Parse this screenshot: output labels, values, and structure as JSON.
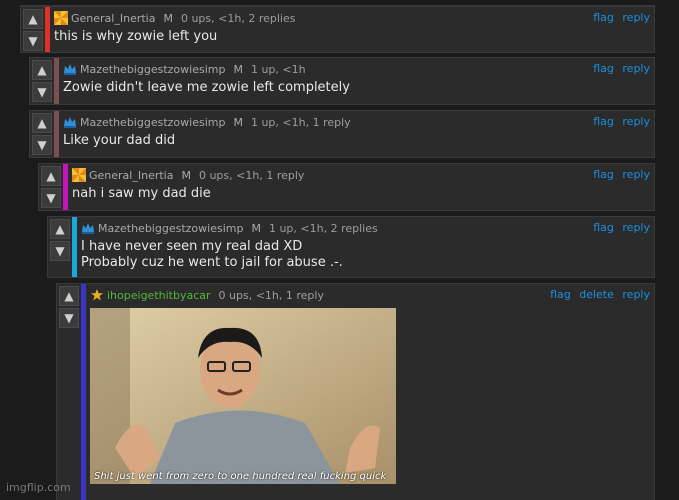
{
  "comments": [
    {
      "username": "General_Inertia",
      "mod": "M",
      "stats": "0 ups, <1h, 2 replies",
      "actions": [
        "flag",
        "reply"
      ],
      "text": "this is why zowie left you",
      "bar_color": "#e0302a",
      "avatar": "pinwheel-avatar"
    },
    {
      "username": "Mazethebiggestzowiesimp",
      "mod": "M",
      "stats": "1 up, <1h",
      "actions": [
        "flag",
        "reply"
      ],
      "text": "Zowie didn't leave me zowie left completely",
      "bar_color": "#7a5050",
      "avatar": "crown-avatar"
    },
    {
      "username": "Mazethebiggestzowiesimp",
      "mod": "M",
      "stats": "1 up, <1h, 1 reply",
      "actions": [
        "flag",
        "reply"
      ],
      "text": "Like your dad did",
      "bar_color": "#7a5050",
      "avatar": "crown-avatar"
    },
    {
      "username": "General_Inertia",
      "mod": "M",
      "stats": "0 ups, <1h, 1 reply",
      "actions": [
        "flag",
        "reply"
      ],
      "text": "nah i saw my dad die",
      "bar_color": "#c216b9",
      "avatar": "pinwheel-avatar"
    },
    {
      "username": "Mazethebiggestzowiesimp",
      "mod": "M",
      "stats": "1 up, <1h, 2 replies",
      "actions": [
        "flag",
        "reply"
      ],
      "text_lines": [
        "I have never seen my real dad XD",
        "Probably cuz he went to jail for abuse .-."
      ],
      "bar_color": "#1aa8d8",
      "avatar": "crown-avatar"
    },
    {
      "username": "ihopeigethitbyacar",
      "stats": "0 ups, <1h, 1 reply",
      "actions": [
        "flag",
        "delete",
        "reply"
      ],
      "bar_color": "#3a33c8",
      "avatar": "star-avatar",
      "image_caption": "Shit just went from zero to one hundred real fucking quick"
    }
  ],
  "watermark": "imgflip.com",
  "colors": {
    "link": "#1a8fe0",
    "green_user": "#4fb83a"
  }
}
